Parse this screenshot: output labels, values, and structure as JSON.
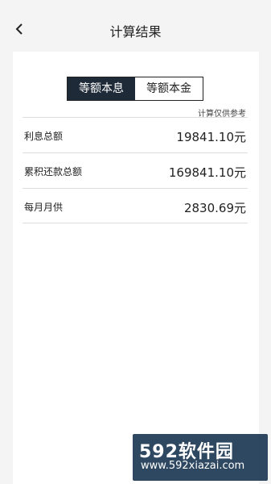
{
  "header": {
    "title": "计算结果",
    "back_icon": "chevron-left-icon"
  },
  "mode_toggle": {
    "options": [
      {
        "label": "等额本息",
        "selected": true
      },
      {
        "label": "等额本金",
        "selected": false
      }
    ]
  },
  "note": "计算仅供参考",
  "results": [
    {
      "label": "利息总额",
      "value": "19841.10元"
    },
    {
      "label": "累积还款总额",
      "value": "169841.10元"
    },
    {
      "label": "每月月供",
      "value": "2830.69元"
    }
  ],
  "watermark": {
    "text": "592软件园",
    "url": "www.592xiazai.com"
  },
  "colors": {
    "active_tab_bg": "#1f2a38",
    "page_bg": "#f4f4f4",
    "card_bg": "#ffffff"
  }
}
